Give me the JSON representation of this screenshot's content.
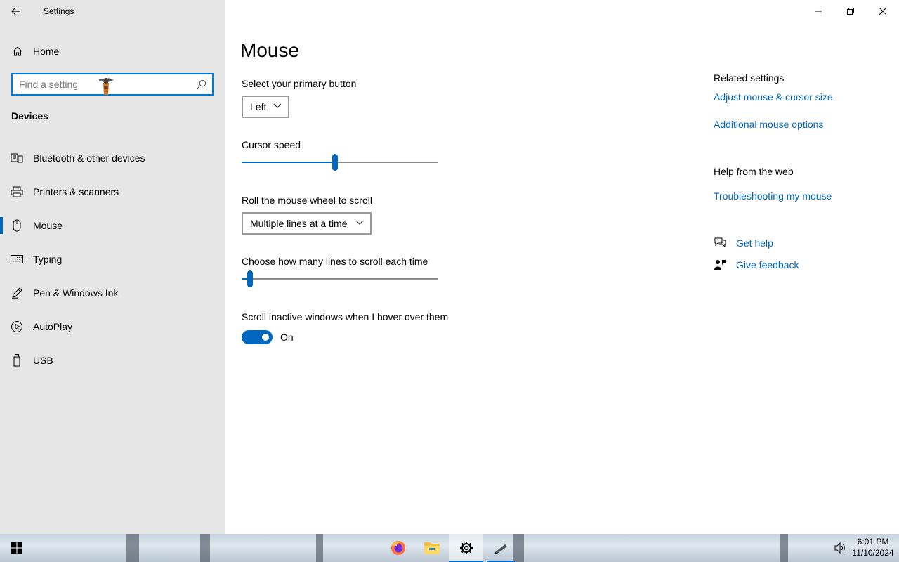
{
  "window": {
    "title": "Settings"
  },
  "sidebar": {
    "home_label": "Home",
    "search_placeholder": "Find a setting",
    "section_heading": "Devices",
    "items": [
      {
        "label": "Bluetooth & other devices",
        "icon": "bluetooth-devices-icon",
        "active": false
      },
      {
        "label": "Printers & scanners",
        "icon": "printer-icon",
        "active": false
      },
      {
        "label": "Mouse",
        "icon": "mouse-icon",
        "active": true
      },
      {
        "label": "Typing",
        "icon": "keyboard-icon",
        "active": false
      },
      {
        "label": "Pen & Windows Ink",
        "icon": "pen-icon",
        "active": false
      },
      {
        "label": "AutoPlay",
        "icon": "autoplay-icon",
        "active": false
      },
      {
        "label": "USB",
        "icon": "usb-icon",
        "active": false
      }
    ]
  },
  "main": {
    "page_title": "Mouse",
    "primary_button": {
      "label": "Select your primary button",
      "value": "Left"
    },
    "cursor_speed": {
      "label": "Cursor speed",
      "value_fraction": 0.475
    },
    "wheel_scroll": {
      "label": "Roll the mouse wheel to scroll",
      "value": "Multiple lines at a time"
    },
    "lines_to_scroll": {
      "label": "Choose how many lines to scroll each time",
      "value_fraction": 0.03
    },
    "scroll_inactive": {
      "label": "Scroll inactive windows when I hover over them",
      "state": "On",
      "on": true
    }
  },
  "related": {
    "heading": "Related settings",
    "links": [
      "Adjust mouse & cursor size",
      "Additional mouse options"
    ],
    "web_heading": "Help from the web",
    "web_link": "Troubleshooting my mouse",
    "get_help": "Get help",
    "give_feedback": "Give feedback"
  },
  "taskbar": {
    "apps": [
      {
        "name": "firefox-icon",
        "state": "pinned"
      },
      {
        "name": "file-explorer-icon",
        "state": "pinned"
      },
      {
        "name": "settings-gear-icon",
        "state": "active"
      },
      {
        "name": "pen-app-icon",
        "state": "open"
      }
    ],
    "time": "6:01 PM",
    "date": "11/10/2024"
  },
  "colors": {
    "accent": "#0067c0",
    "focus_border": "#0078d7",
    "sidebar_bg": "#e6e6e6"
  }
}
